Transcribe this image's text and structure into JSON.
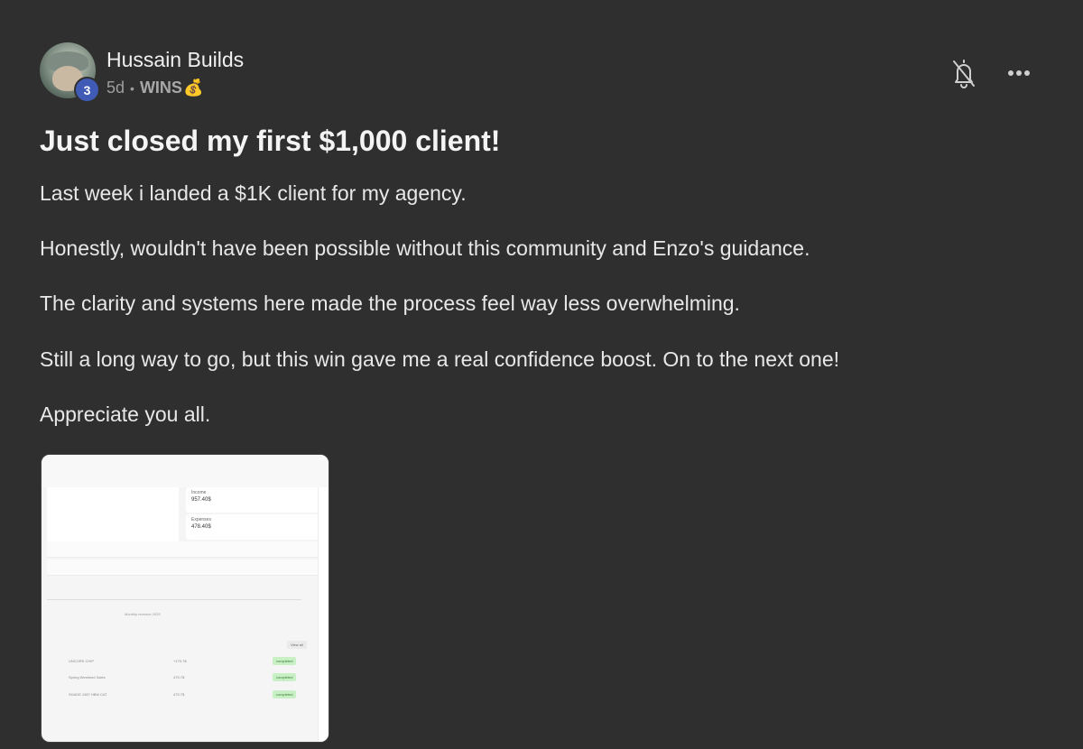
{
  "post": {
    "author": "Hussain Builds",
    "level": "3",
    "age": "5d",
    "category": "WINS",
    "category_emoji": "💰",
    "title": "Just closed my first $1,000 client!",
    "paragraphs": [
      "Last week i landed a $1K client for my agency.",
      "Honestly, wouldn't have been possible without this community and Enzo's guidance.",
      "The clarity and systems here made the process feel way less overwhelming.",
      "Still a long way to go, but this win gave me a real confidence boost. On to the next one!",
      "Appreciate you all."
    ]
  },
  "attachment": {
    "cards": [
      {
        "label": "Income",
        "value": "957.40$"
      },
      {
        "label": "Expenses",
        "value": "478.40$"
      }
    ],
    "caption": "Monthly revenue 2025",
    "view_all": "View all",
    "transactions": [
      {
        "name": "UNCORE.CHIP",
        "amount": "+175.7$",
        "status": "completed"
      },
      {
        "name": "Spring Weekend Sales",
        "amount": "475.7$",
        "status": "completed"
      },
      {
        "name": "SHADE 1987 HBM CAT",
        "amount": "475.7$",
        "status": "completed"
      }
    ]
  },
  "icons": {
    "bell": "bell-off-icon",
    "more": "more-horizontal-icon"
  },
  "colors": {
    "background": "#2f2f2f",
    "level_badge": "#3f5bb5",
    "text": "#e8e8e8",
    "meta_text": "#9d9d9d"
  }
}
